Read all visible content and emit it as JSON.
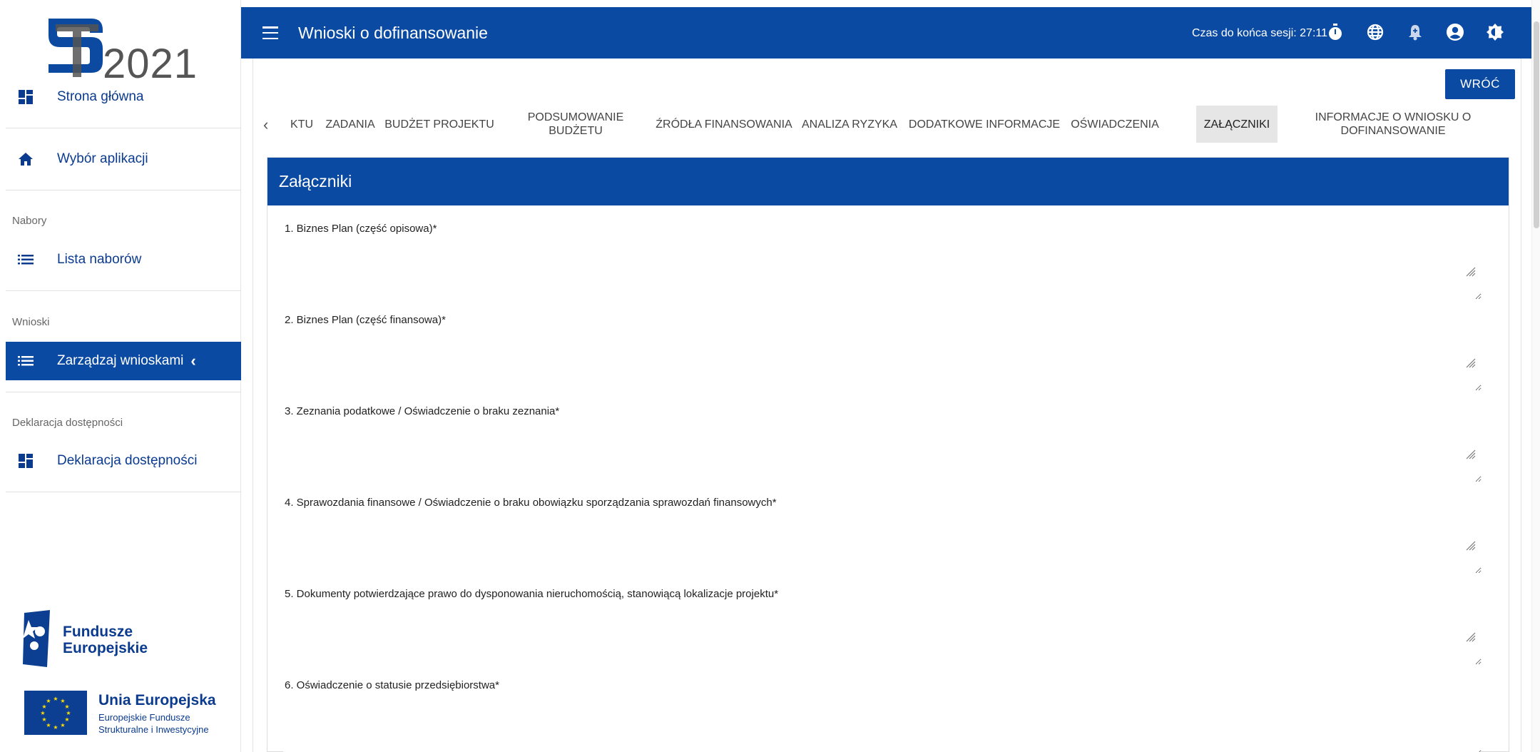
{
  "brand": {
    "logo_text": "2021"
  },
  "sidebar": {
    "items": [
      {
        "label": "Strona główna",
        "icon": "dashboard-icon"
      },
      {
        "label": "Wybór aplikacji",
        "icon": "home-icon"
      },
      {
        "section": "Nabory"
      },
      {
        "label": "Lista naborów",
        "icon": "list-icon"
      },
      {
        "section": "Wnioski"
      },
      {
        "label": "Zarządzaj wnioskami",
        "icon": "list-icon",
        "active": true
      },
      {
        "section": "Deklaracja dostępności"
      },
      {
        "label": "Deklaracja dostępności",
        "icon": "dashboard-icon"
      }
    ],
    "section_nabory": "Nabory",
    "section_wnioski": "Wnioski",
    "section_deklaracja": "Deklaracja dostępności",
    "item_home": "Strona główna",
    "item_apps": "Wybór aplikacji",
    "item_nabory": "Lista naborów",
    "item_wnioski": "Zarządzaj wnioskami",
    "item_deklaracja": "Deklaracja dostępności",
    "fe_line1": "Fundusze",
    "fe_line2": "Europejskie",
    "eu_title": "Unia Europejska",
    "eu_line1": "Europejskie Fundusze",
    "eu_line2": "Strukturalne i Inwestycyjne"
  },
  "topbar": {
    "title": "Wnioski o dofinansowanie",
    "session_text": "Czas do końca sesji: 27:11"
  },
  "main": {
    "back_label": "WRÓĆ",
    "tabs": [
      "KTU",
      "ZADANIA",
      "BUDŻET PROJEKTU",
      "PODSUMOWANIE BUDŻETU",
      "ŹRÓDŁA FINANSOWANIA",
      "ANALIZA RYZYKA",
      "DODATKOWE INFORMACJE",
      "OŚWIADCZENIA",
      "ZAŁĄCZNIKI",
      "INFORMACJE O WNIOSKU O DOFINANSOWANIE"
    ],
    "active_tab": "ZAŁĄCZNIKI",
    "panel_title": "Załączniki",
    "fields": [
      "1. Biznes Plan (część opisowa)*",
      "2. Biznes Plan (część finansowa)*",
      "3. Zeznania podatkowe / Oświadczenie o braku zeznania*",
      "4. Sprawozdania finansowe / Oświadczenie o braku obowiązku sporządzania sprawozdań finansowych*",
      "5. Dokumenty potwierdzające prawo do dysponowania nieruchomością, stanowiącą lokalizacje projektu*",
      "6. Oświadczenie o statusie przedsiębiorstwa*"
    ]
  },
  "colors": {
    "primary": "#0b4aa2",
    "active_tab_bg": "#e6e6e6"
  }
}
